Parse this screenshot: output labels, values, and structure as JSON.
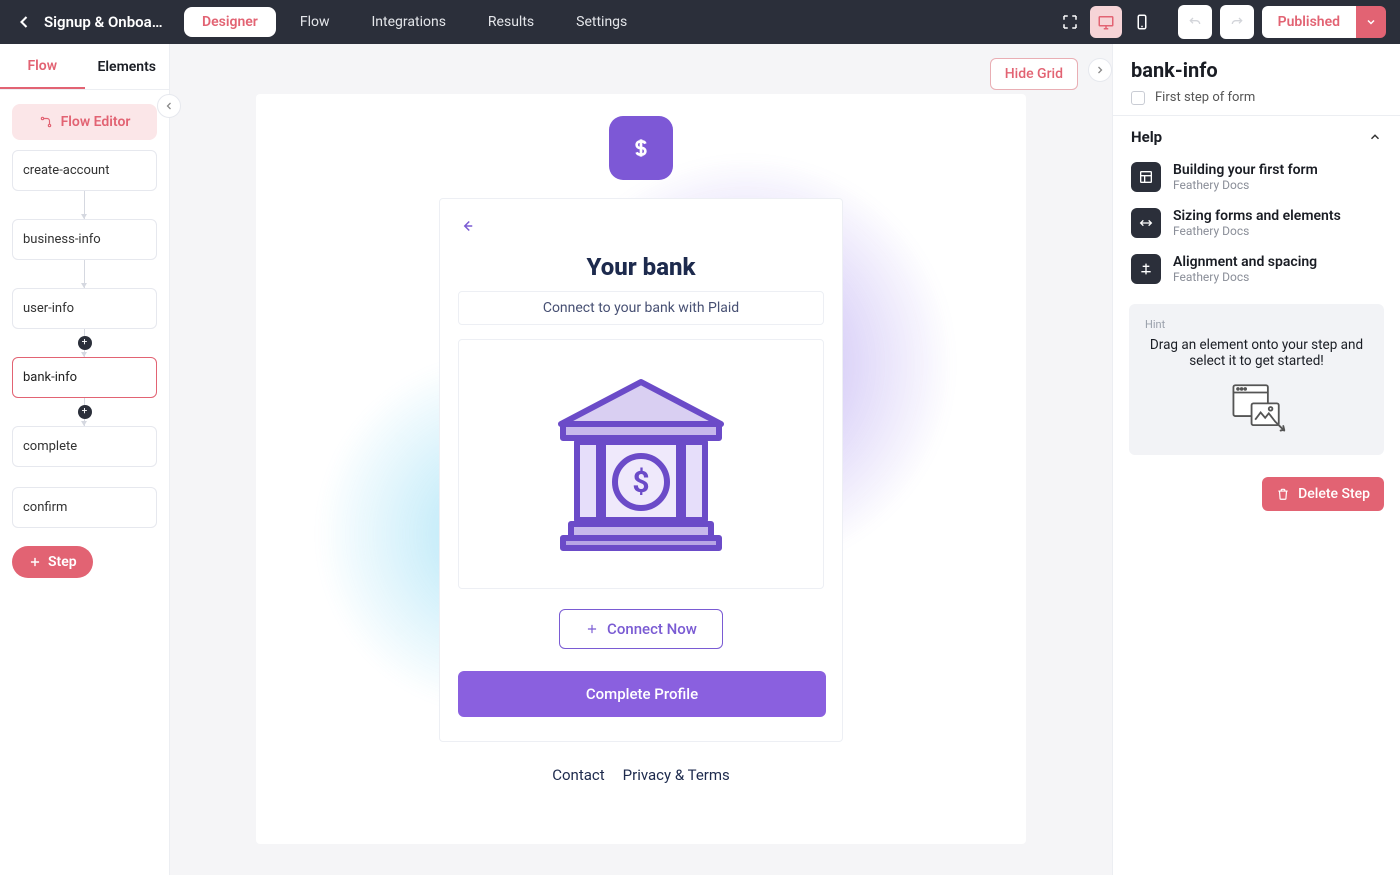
{
  "topbar": {
    "form_name": "Signup & Onboar…",
    "nav": {
      "designer": "Designer",
      "flow": "Flow",
      "integrations": "Integrations",
      "results": "Results",
      "settings": "Settings"
    },
    "publish_label": "Published"
  },
  "left": {
    "tabs": {
      "flow": "Flow",
      "elements": "Elements"
    },
    "flow_editor_label": "Flow Editor",
    "steps": [
      {
        "id": "create-account",
        "label": "create-account"
      },
      {
        "id": "business-info",
        "label": "business-info"
      },
      {
        "id": "user-info",
        "label": "user-info"
      },
      {
        "id": "bank-info",
        "label": "bank-info"
      },
      {
        "id": "complete",
        "label": "complete"
      },
      {
        "id": "confirm",
        "label": "confirm"
      }
    ],
    "add_step_label": "Step"
  },
  "canvas": {
    "hide_grid_label": "Hide Grid",
    "card": {
      "title": "Your bank",
      "subtitle": "Connect to your bank with Plaid",
      "connect_label": "Connect Now",
      "complete_label": "Complete Profile"
    },
    "footer": {
      "contact": "Contact",
      "privacy": "Privacy & Terms"
    }
  },
  "right": {
    "title": "bank-info",
    "first_step_label": "First step of form",
    "help_header": "Help",
    "help": [
      {
        "title": "Building your first form",
        "sub": "Feathery Docs",
        "icon": "layout"
      },
      {
        "title": "Sizing forms and elements",
        "sub": "Feathery Docs",
        "icon": "resize"
      },
      {
        "title": "Alignment and spacing",
        "sub": "Feathery Docs",
        "icon": "align"
      }
    ],
    "hint_label": "Hint",
    "hint_msg": "Drag an element onto your step and select it to get started!",
    "delete_label": "Delete Step"
  }
}
